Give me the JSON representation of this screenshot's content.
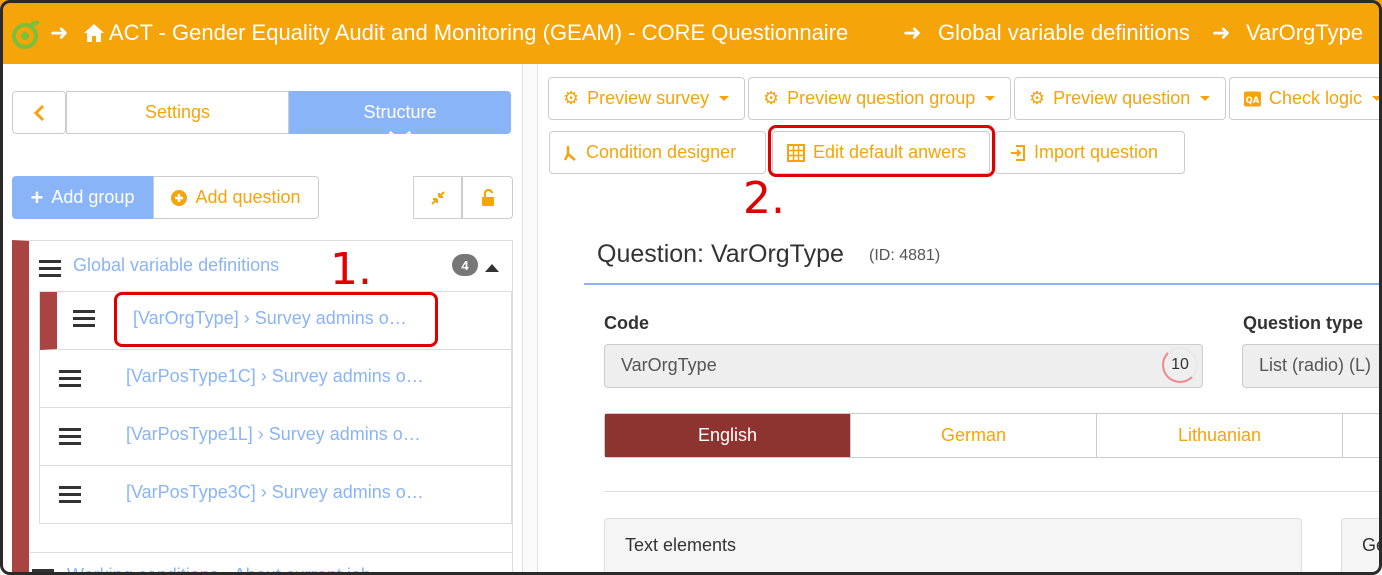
{
  "breadcrumb": {
    "items": [
      "ACT - Gender Equality Audit and Monitoring (GEAM) - CORE Questionnaire",
      "Global variable definitions",
      "VarOrgType"
    ]
  },
  "sidebar": {
    "tabs": {
      "settings": "Settings",
      "structure": "Structure"
    },
    "add_group": "Add group",
    "add_question": "Add question",
    "group": {
      "title": "Global variable definitions",
      "count": "4",
      "questions": [
        "[VarOrgType] › Survey admins o…",
        "[VarPosType1C] › Survey admins o…",
        "[VarPosType1L] › Survey admins o…",
        "[VarPosType3C] › Survey admins o…"
      ]
    },
    "next_group": {
      "title": "Working conditions - About current job"
    }
  },
  "annotations": {
    "one": "1.",
    "two": "2."
  },
  "toolbar": {
    "preview_survey": "Preview survey",
    "preview_group": "Preview question group",
    "preview_question": "Preview question",
    "check_logic": "Check logic",
    "condition_designer": "Condition designer",
    "edit_default_answers": "Edit default anwers",
    "import_question": "Import question"
  },
  "question": {
    "title": "Question: VarOrgType",
    "id": "(ID: 4881)",
    "code_label": "Code",
    "code_value": "VarOrgType",
    "code_counter": "10",
    "type_label": "Question type",
    "type_value": "List (radio) (L)"
  },
  "languages": [
    "English",
    "German",
    "Lithuanian"
  ],
  "panels": {
    "text_elements": "Text elements",
    "general": "Ge"
  },
  "colors": {
    "accent": "#f5a40a",
    "primary_blue": "#8ab4f8",
    "active_lang": "#8e3430",
    "group_marker": "#a94442",
    "annotation": "#e00000"
  }
}
